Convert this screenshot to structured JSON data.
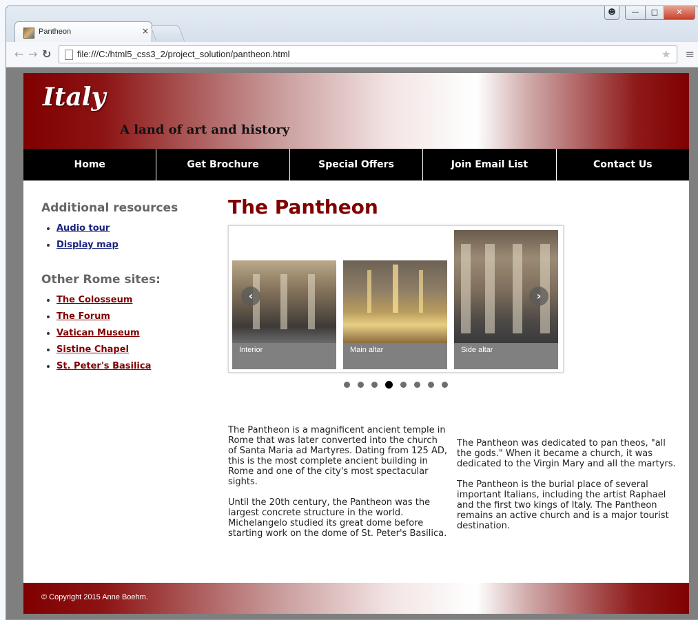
{
  "browser": {
    "tab_title": "Pantheon",
    "tab_close": "×",
    "url": "file:///C:/html5_css3_2/project_solution/pantheon.html"
  },
  "header": {
    "logo": "Italy",
    "tagline": "A land of art and history"
  },
  "nav": [
    {
      "label": "Home"
    },
    {
      "label": "Get Brochure"
    },
    {
      "label": "Special Offers"
    },
    {
      "label": "Join Email List"
    },
    {
      "label": "Contact Us"
    }
  ],
  "sidebar": {
    "resources_heading": "Additional resources",
    "resources": [
      {
        "label": "Audio tour"
      },
      {
        "label": "Display map"
      }
    ],
    "sites_heading": "Other Rome sites:",
    "sites": [
      {
        "label": "The Colosseum"
      },
      {
        "label": "The Forum"
      },
      {
        "label": "Vatican Museum"
      },
      {
        "label": "Sistine Chapel"
      },
      {
        "label": "St. Peter's Basilica"
      }
    ]
  },
  "main": {
    "title": "The Pantheon",
    "carousel": {
      "slides": [
        {
          "caption": "Interior"
        },
        {
          "caption": "Main altar"
        },
        {
          "caption": "Side altar"
        }
      ],
      "prev_arrow": "‹",
      "next_arrow": "›",
      "dot_count": 8,
      "active_dot": 4
    },
    "paragraphs_left": [
      "The Pantheon is a magnificent ancient temple in Rome that was later converted into the church of Santa Maria ad Martyres. Dating from 125 AD, this is the most complete ancient building in Rome and one of the city's most spectacular sights.",
      "Until the 20th century, the Pantheon was the largest concrete structure in the world. Michelangelo studied its great dome before starting work on the dome of St. Peter's Basilica."
    ],
    "paragraphs_right": [
      "The Pantheon was dedicated to pan theos, \"all the gods.\" When it became a church, it was dedicated to the Virgin Mary and all the martyrs.",
      "The Pantheon is the burial place of several important Italians, including the artist Raphael and the first two kings of Italy. The Pantheon remains an active church and is a major tourist destination."
    ]
  },
  "footer": {
    "copyright": "© Copyright 2015 Anne Boehm."
  },
  "colors": {
    "brand_maroon": "#800000",
    "nav_background": "#000000",
    "link_blue": "#1a237e"
  }
}
